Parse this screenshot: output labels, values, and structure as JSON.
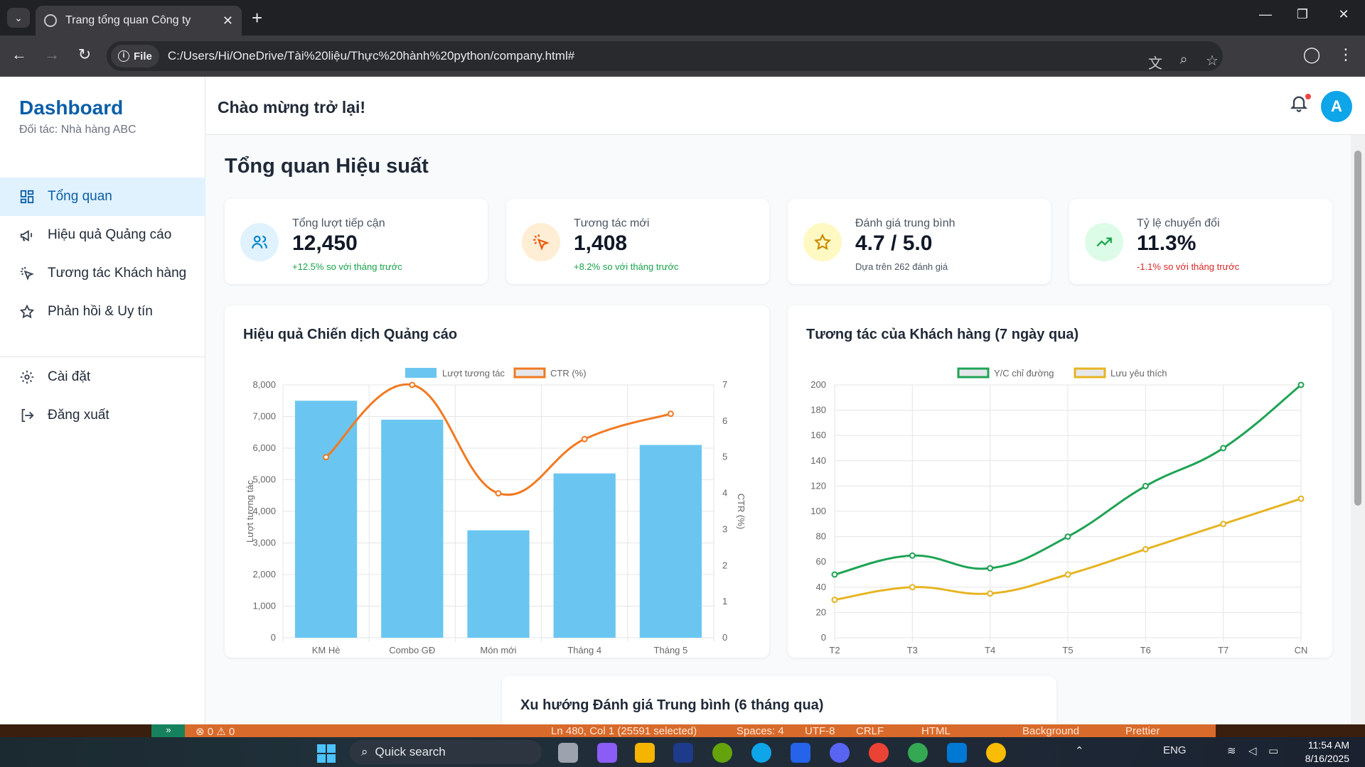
{
  "browser": {
    "tab_title": "Trang tổng quan Công ty",
    "file_chip": "File",
    "url": "C:/Users/Hi/OneDrive/Tài%20liệu/Thực%20hành%20python/company.html#"
  },
  "sidebar": {
    "brand": "Dashboard",
    "partner": "Đối tác: Nhà hàng ABC",
    "items": [
      {
        "label": "Tổng quan",
        "icon": "grid-icon",
        "active": true
      },
      {
        "label": "Hiệu quả Quảng cáo",
        "icon": "megaphone-icon"
      },
      {
        "label": "Tương tác Khách hàng",
        "icon": "pointer-click-icon"
      },
      {
        "label": "Phản hồi & Uy tín",
        "icon": "star-icon"
      }
    ],
    "settings_label": "Cài đặt",
    "logout_label": "Đăng xuất"
  },
  "header": {
    "welcome": "Chào mừng trở lại!",
    "avatar_letter": "A"
  },
  "main": {
    "title": "Tổng quan Hiệu suất",
    "stats": [
      {
        "label": "Tổng lượt tiếp cận",
        "value": "12,450",
        "sub": "+12.5% so với tháng trước",
        "icon": "users-icon",
        "sub_color": "#16a34a",
        "icon_bg": "#e0f2fe",
        "icon_color": "#0284c7"
      },
      {
        "label": "Tương tác mới",
        "value": "1,408",
        "sub": "+8.2% so với tháng trước",
        "icon": "pointer-click-icon",
        "sub_color": "#16a34a",
        "icon_bg": "#ffedd5",
        "icon_color": "#ea580c"
      },
      {
        "label": "Đánh giá trung bình",
        "value": "4.7 / 5.0",
        "sub": "Dựa trên 262 đánh giá",
        "icon": "star-icon",
        "sub_color": "#4b5563",
        "icon_bg": "#fef9c3",
        "icon_color": "#ca8a04"
      },
      {
        "label": "Tỷ lệ chuyển đổi",
        "value": "11.3%",
        "sub": "-1.1% so với tháng trước",
        "icon": "trending-up-icon",
        "sub_color": "#dc2626",
        "icon_bg": "#dcfce7",
        "icon_color": "#16a34a"
      }
    ],
    "bottom_card_title": "Xu hướng Đánh giá Trung bình (6 tháng qua)"
  },
  "chart_data": [
    {
      "type": "bar",
      "title": "Hiệu quả Chiến dịch Quảng cáo",
      "categories": [
        "KM Hè",
        "Combo GĐ",
        "Món mới",
        "Tháng 4",
        "Tháng 5"
      ],
      "ylabel": "Lượt tương tác",
      "y2label": "CTR (%)",
      "ylim": [
        0,
        8000
      ],
      "y2lim": [
        0,
        7
      ],
      "yticks": [
        "0",
        "1,000",
        "2,000",
        "3,000",
        "4,000",
        "5,000",
        "6,000",
        "7,000",
        "8,000"
      ],
      "y2ticks": [
        "0",
        "1",
        "2",
        "3",
        "4",
        "5",
        "6",
        "7"
      ],
      "series": [
        {
          "name": "Lượt tương tác",
          "kind": "bar",
          "axis": "left",
          "values": [
            7500,
            6900,
            3400,
            5200,
            6100
          ],
          "color": "#6ac6f0"
        },
        {
          "name": "CTR (%)",
          "kind": "line",
          "axis": "right",
          "values": [
            5.0,
            7.0,
            4.0,
            5.5,
            6.2
          ],
          "color": "#f07a22"
        }
      ],
      "legend": "top",
      "grid": true
    },
    {
      "type": "line",
      "title": "Tương tác của Khách hàng (7 ngày qua)",
      "categories": [
        "T2",
        "T3",
        "T4",
        "T5",
        "T6",
        "T7",
        "CN"
      ],
      "ylim": [
        0,
        200
      ],
      "yticks": [
        "0",
        "20",
        "40",
        "60",
        "80",
        "100",
        "120",
        "140",
        "160",
        "180",
        "200"
      ],
      "series": [
        {
          "name": "Y/C chỉ đường",
          "values": [
            50,
            65,
            55,
            80,
            120,
            150,
            200
          ],
          "color": "#1fa355"
        },
        {
          "name": "Lưu yêu thích",
          "values": [
            30,
            40,
            35,
            50,
            70,
            90,
            110
          ],
          "color": "#e6b422"
        }
      ],
      "legend": "top",
      "grid": true
    }
  ],
  "vscode_status": {
    "errors": "⊗ 0 ⚠ 0",
    "position": "Ln 480, Col 1 (25591 selected)",
    "spaces": "Spaces: 4",
    "encoding": "UTF-8",
    "eol": "CRLF",
    "language": "HTML",
    "background": "Background",
    "prettier": "Prettier"
  },
  "taskbar": {
    "search_label": "Quick search",
    "lang": "ENG",
    "time": "11:54 AM",
    "date": "8/16/2025"
  }
}
